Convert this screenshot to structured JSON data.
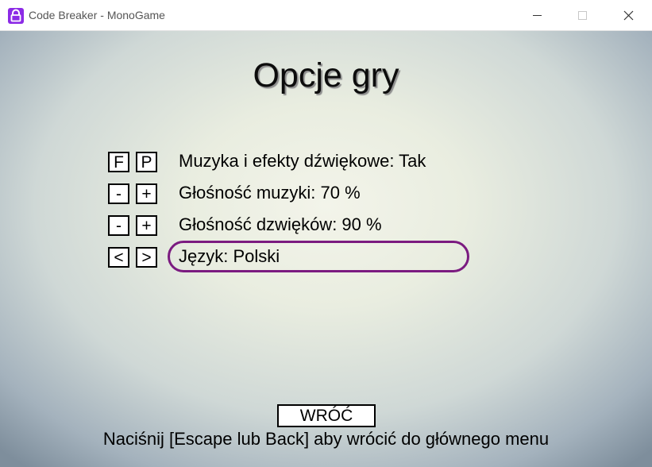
{
  "window": {
    "title": "Code Breaker - MonoGame",
    "icon": "lock-icon",
    "controls": [
      "minimize-icon",
      "maximize-icon",
      "close-icon"
    ]
  },
  "screen": {
    "title": "Opcje gry",
    "options": [
      {
        "keys": [
          "F",
          "P"
        ],
        "label": "Muzyka i efekty dźwiękowe: Tak"
      },
      {
        "keys": [
          "-",
          "+"
        ],
        "label": "Głośność muzyki: 70 %"
      },
      {
        "keys": [
          "-",
          "+"
        ],
        "label": "Głośność dzwięków: 90 %"
      },
      {
        "keys": [
          "<",
          ">"
        ],
        "label": "Język: Polski",
        "selected": true
      }
    ],
    "back_button": "WRÓĆ",
    "hint": "Naciśnij [Escape lub Back] aby wrócić do głównego menu"
  },
  "colors": {
    "selection_outline": "#7b1b80",
    "app_icon": "#8c2be6"
  }
}
